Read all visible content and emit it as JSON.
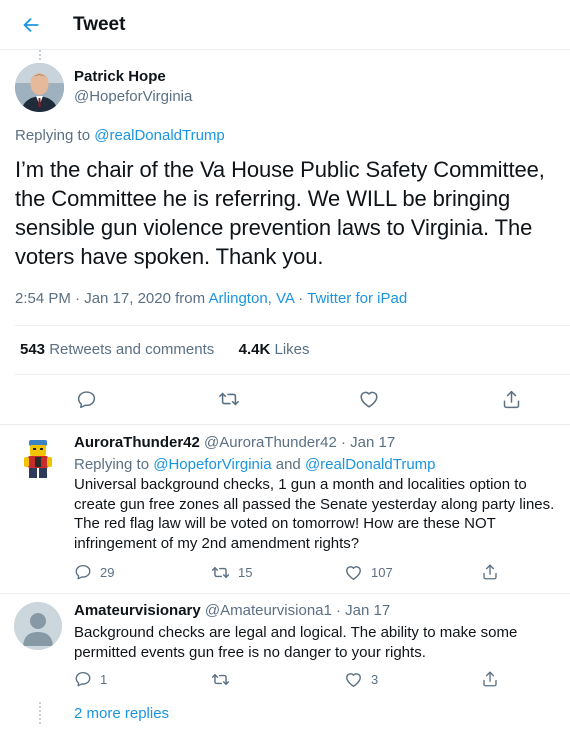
{
  "header": {
    "title": "Tweet",
    "back_icon": "arrow-left-icon"
  },
  "colors": {
    "accent": "#1b95e0",
    "secondary_text": "#5b7083",
    "border": "#ebeef0"
  },
  "main_tweet": {
    "name": "Patrick Hope",
    "handle": "@HopeforVirginia",
    "replying_prefix": "Replying to ",
    "replying_to": "@realDonaldTrump",
    "text": "I’m the chair of the Va House Public Safety Committee, the Committee he is referring. We WILL be bringing sensible gun violence prevention laws to Virginia. The voters have spoken. Thank you.",
    "time": "2:54 PM · Jan 17, 2020 from ",
    "location": "Arlington, VA",
    "dot": " · ",
    "source": "Twitter for iPad",
    "retweets_count": "543",
    "retweets_label": "Retweets and comments",
    "likes_count": "4.4K",
    "likes_label": "Likes"
  },
  "replies": [
    {
      "name": "AuroraThunder42",
      "handle_date": "@AuroraThunder42 · Jan 17",
      "replying_prefix": "Replying to ",
      "replying_to_1": "@HopeforVirginia",
      "and": " and ",
      "replying_to_2": "@realDonaldTrump",
      "text": "Universal background checks, 1 gun a month and localities option to create gun free zones all passed the Senate yesterday along party lines. The red flag law will be voted on tomorrow!  How are these NOT infringement of my 2nd amendment rights?",
      "comments": "29",
      "retweets": "15",
      "likes": "107"
    },
    {
      "name": "Amateurvisionary",
      "handle_date": "@Amateurvisiona1 · Jan 17",
      "text": "Background checks are legal and logical. The ability to make some permitted events gun free is no danger to your rights.",
      "comments": "1",
      "retweets": "",
      "likes": "3"
    }
  ],
  "more_replies": "2 more replies"
}
